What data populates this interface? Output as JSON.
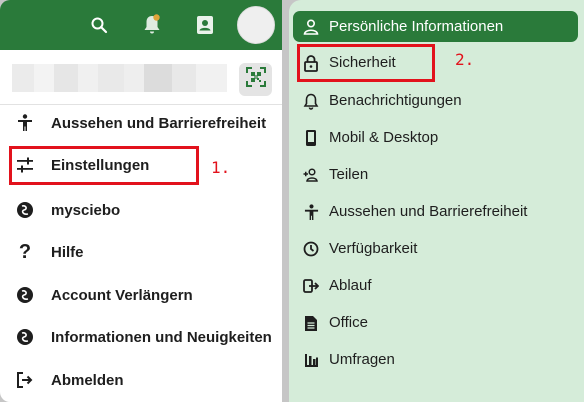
{
  "header": {
    "icons": [
      "search-icon",
      "notification-icon",
      "contacts-icon"
    ]
  },
  "profile": {
    "name_obscured": true,
    "qr_icon": "qr-code-icon"
  },
  "menu": {
    "items": [
      {
        "label": "Aussehen und Barrierefreiheit",
        "icon": "accessibility-icon"
      },
      {
        "label": "Einstellungen",
        "icon": "settings-sliders-icon"
      },
      {
        "label": "mysciebo",
        "icon": "sciebo-icon"
      },
      {
        "label": "Hilfe",
        "icon": "help-icon"
      },
      {
        "label": "Account Verlängern",
        "icon": "sciebo-icon"
      },
      {
        "label": "Informationen und Neuigkeiten",
        "icon": "sciebo-icon"
      },
      {
        "label": "Abmelden",
        "icon": "logout-icon"
      }
    ]
  },
  "settings_nav": {
    "items": [
      {
        "label": "Persönliche Informationen",
        "icon": "person-icon",
        "active": true
      },
      {
        "label": "Sicherheit",
        "icon": "lock-icon"
      },
      {
        "label": "Benachrichtigungen",
        "icon": "bell-icon"
      },
      {
        "label": "Mobil & Desktop",
        "icon": "phone-icon"
      },
      {
        "label": "Teilen",
        "icon": "share-person-icon"
      },
      {
        "label": "Aussehen und Barrierefreiheit",
        "icon": "accessibility-icon"
      },
      {
        "label": "Verfügbarkeit",
        "icon": "clock-icon"
      },
      {
        "label": "Ablauf",
        "icon": "flow-icon"
      },
      {
        "label": "Office",
        "icon": "document-icon"
      },
      {
        "label": "Umfragen",
        "icon": "poll-icon"
      }
    ]
  },
  "annotations": {
    "step1": "1.",
    "step2": "2."
  },
  "colors": {
    "brand_green": "#2a7a3a",
    "sidebar_bg": "#d5ecd9",
    "annotation_red": "#e2121c"
  }
}
